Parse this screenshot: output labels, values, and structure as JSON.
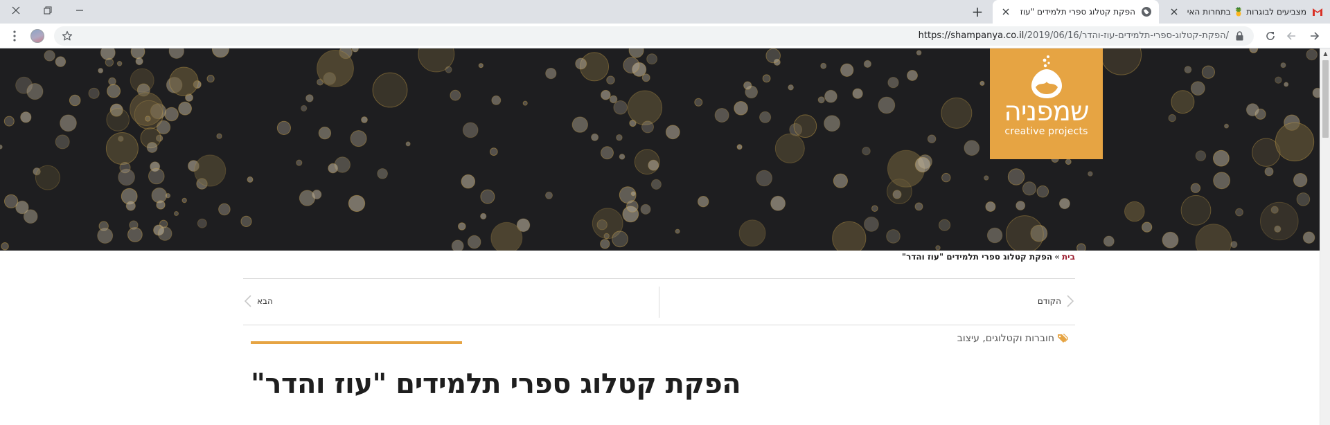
{
  "browser": {
    "tabs": [
      {
        "title": "הפקת קטלוג ספרי תלמידים \"עוז והדר\"",
        "favicon": "globe-icon",
        "active": true
      },
      {
        "title": "מצביעים לבוגרות 🍍 בתחרות האי",
        "favicon": "gmail-icon",
        "active": false
      }
    ],
    "new_tab_label": "+",
    "url_host": "https://shampanya.co.il",
    "url_path": "/2019/06/16/הפקת-קטלוג-ספרי-תלמידים-עוז-והדר/"
  },
  "site": {
    "logo_text": "שמפניה",
    "logo_subtitle": "creative projects",
    "accent_color": "#e6a443"
  },
  "breadcrumb": {
    "home": "בית",
    "separator": "»",
    "current": "הפקת קטלוג ספרי תלמידים \"עוז והדר\""
  },
  "post_nav": {
    "prev_label": "הקודם",
    "next_label": "הבא"
  },
  "post": {
    "categories": "חוברות וקטלוגים, עיצוב",
    "title": "הפקת קטלוג ספרי תלמידים \"עוז והדר\""
  }
}
